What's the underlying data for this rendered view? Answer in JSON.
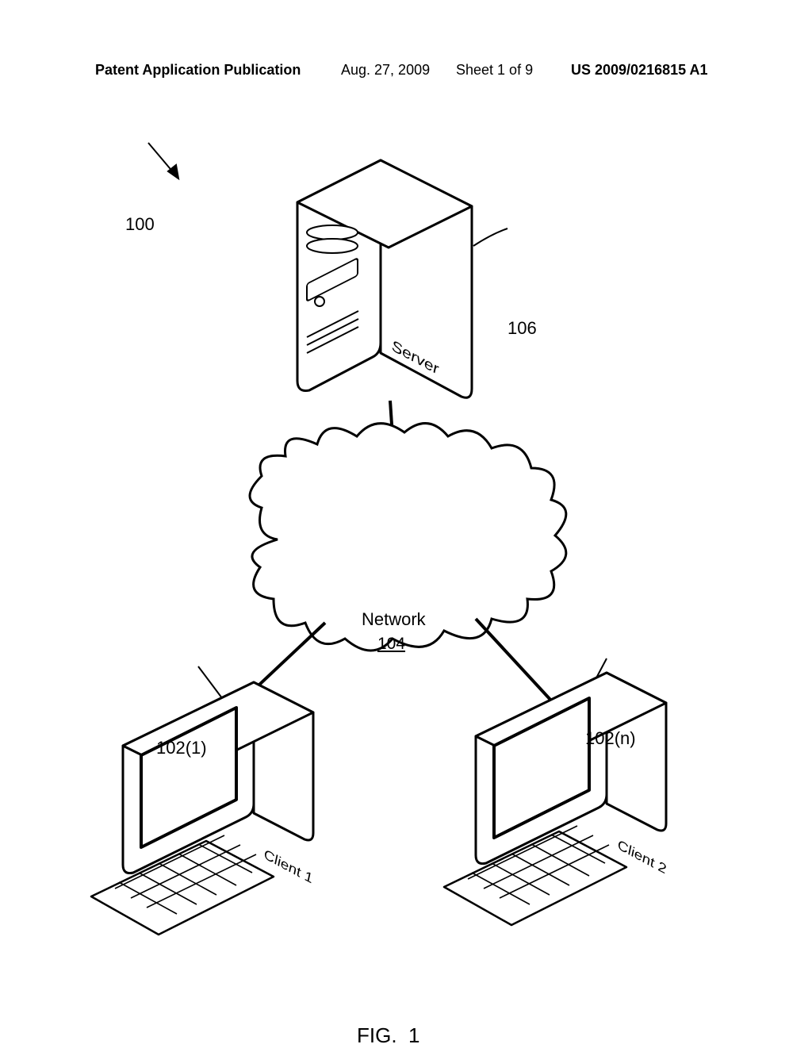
{
  "header": {
    "publication": "Patent Application Publication",
    "date": "Aug. 27, 2009",
    "sheet": "Sheet 1 of 9",
    "number": "US 2009/0216815 A1"
  },
  "figure": {
    "caption_fig": "FIG.",
    "caption_num": "1",
    "system_ref": "100",
    "server": {
      "label": "Server",
      "ref": "106"
    },
    "network": {
      "label": "Network",
      "ref": "104"
    },
    "clients": [
      {
        "label": "Client 1",
        "ref": "102(1)"
      },
      {
        "label": "Client 2",
        "ref": "102(n)"
      }
    ]
  }
}
